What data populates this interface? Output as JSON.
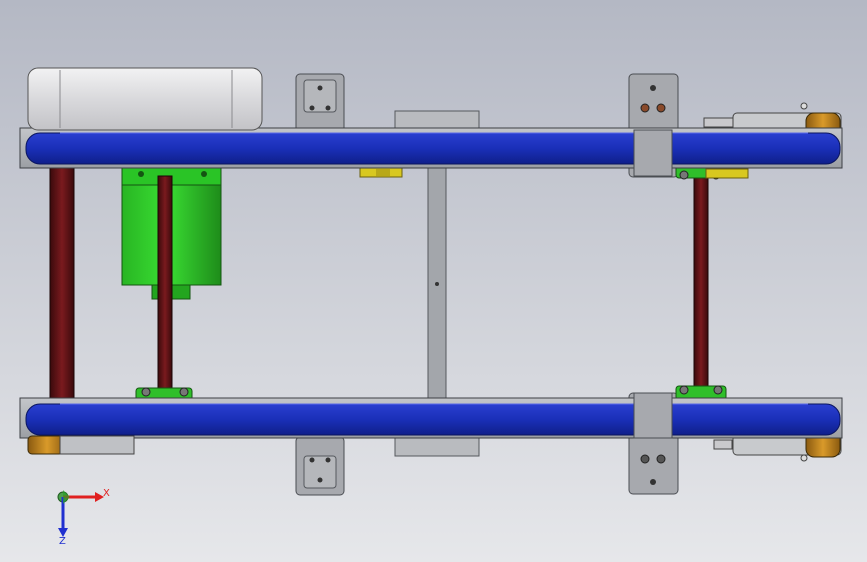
{
  "viewport": {
    "background_top": "#b4b8c4",
    "background_bottom": "#e6e7ea"
  },
  "colors": {
    "belt": "#1a2fb8",
    "frame": "#a9acb1",
    "shaft": "#6a1418",
    "motor": "#2fcf2a",
    "bearing": "#2fbf2a",
    "roller_end": "#c9861a",
    "sensor": "#d8c820",
    "guard": "#e2e2e4"
  },
  "triad": {
    "x_label": "X",
    "z_label": "Z",
    "x_color": "#e02020",
    "y_color": "#20b020",
    "z_color": "#2030d0"
  }
}
